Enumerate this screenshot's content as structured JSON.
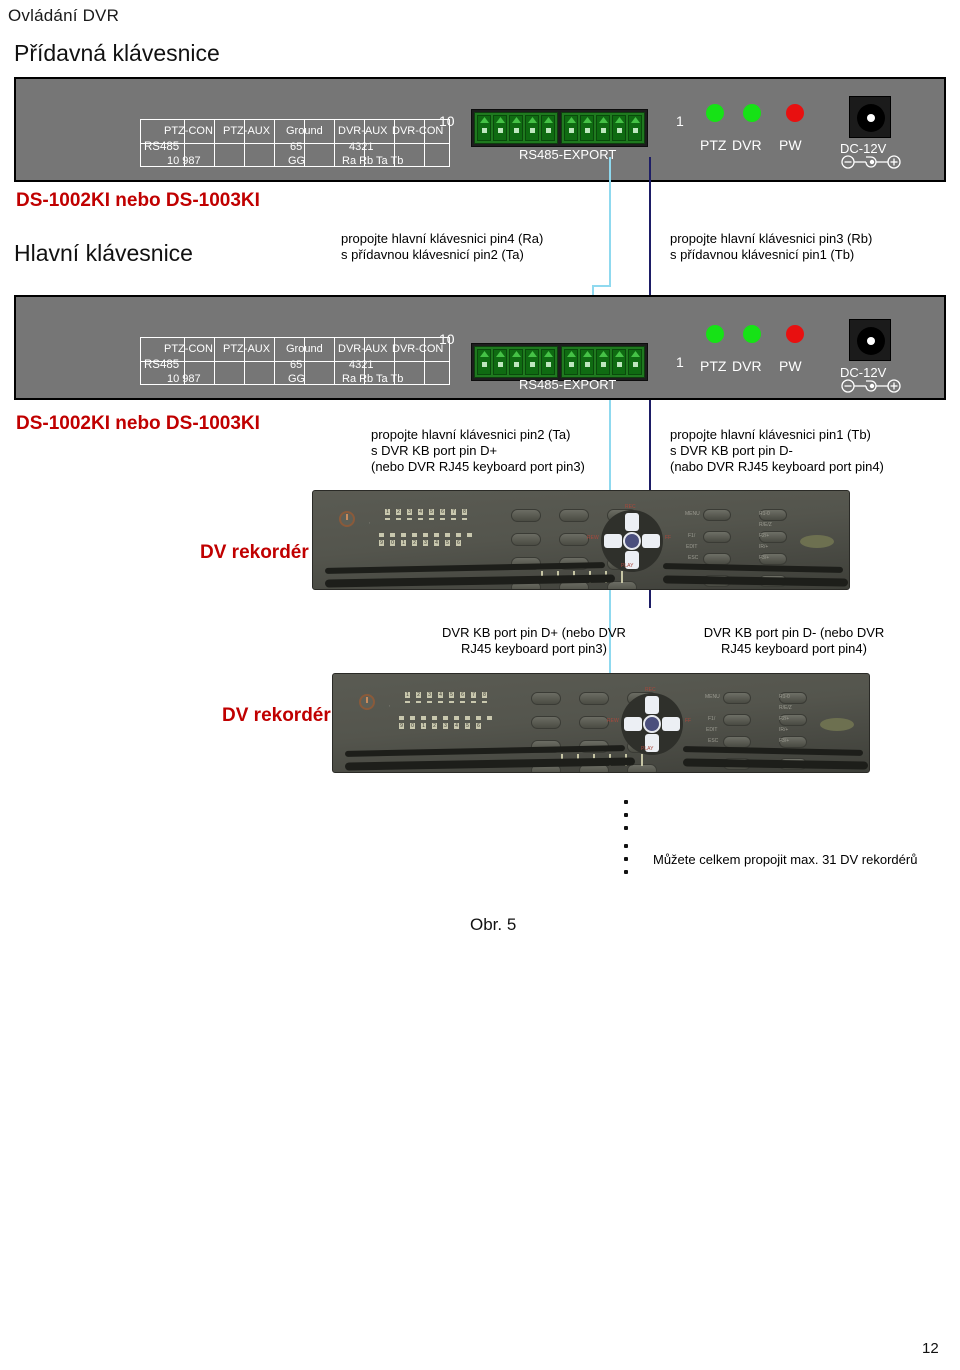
{
  "document": {
    "header": "Ovládání DVR",
    "figure_caption": "Obr. 5",
    "page_number": "12"
  },
  "sections": {
    "aux_keyboard_title": "Přídavná klávesnice",
    "main_keyboard_title": "Hlavní klávesnice",
    "model_label_1": "DS-1002KI nebo DS-1003KI",
    "model_label_2": "DS-1002KI nebo DS-1003KI",
    "dv_recorder_1": "DV rekordér",
    "dv_recorder_2": "DV rekordér"
  },
  "pin_table": {
    "rs485": "RS485",
    "ptz_con": "PTZ-CON",
    "ptz_aux": "PTZ-AUX",
    "ground": "Ground",
    "dvr_aux": "DVR-AUX",
    "dvr_con": "DVR-CON",
    "ptz_nums_top": "10 987",
    "ground_nums": "65",
    "ground_letters": "GG",
    "dvr_nums": "4321",
    "dvr_letters": "Ra Rb Ta Tb"
  },
  "terminal": {
    "label": "RS485-EXPORT",
    "num_left": "10",
    "num_right": "1",
    "pin_count": 10
  },
  "indicators": {
    "ptz_label": "PTZ",
    "dvr_label": "DVR",
    "pw_label": "PW",
    "ptz_color": "#16e216",
    "dvr_color": "#16e216",
    "pw_color": "#e81010",
    "dc_label": "DC-12V"
  },
  "annotations": {
    "a1_line1": "propojte hlavní klávesnici pin4 (Ra)",
    "a1_line2": "s přídavnou klávesnicí pin2 (Ta)",
    "a2_line1": "propojte hlavní klávesnici pin3 (Rb)",
    "a2_line2": "s přídavnou klávesnicí pin1 (Tb)",
    "b1_line1": "propojte hlavní klávesnici pin2 (Ta)",
    "b1_line2": "s DVR KB port pin D+",
    "b1_line3": "(nebo DVR  RJ45 keyboard port pin3)",
    "b2_line1": "propojte hlavní klávesnici pin1 (Tb)",
    "b2_line2": "s DVR KB port pin D-",
    "b2_line3": "(nabo DVR RJ45 keyboard port pin4)",
    "c1_line1": "DVR KB port pin D+ (nebo DVR",
    "c1_line2": "RJ45 keyboard port pin3)",
    "c2_line1": "DVR KB port pin D- (nebo DVR",
    "c2_line2": "RJ45 keyboard port pin4)",
    "footer_note": "Můžete celkem propojit max. 31 DV rekordérů"
  },
  "dvr_panel": {
    "led_labels_top": [
      "1",
      "2",
      "3",
      "4",
      "5",
      "6",
      "7",
      "8"
    ],
    "led_labels_bottom": [
      "9",
      "0",
      "1",
      "2",
      "3",
      "4",
      "5",
      "6"
    ],
    "side_labels": [
      "MENU",
      "",
      "F1/",
      "EDIT",
      "ESC"
    ],
    "right_labels": [
      "R1-0",
      "R/E/Z",
      "F2/+",
      "IR/+",
      "F3/+"
    ],
    "dpad_hints": [
      "REC",
      "REW",
      "FF",
      "PLAY"
    ]
  },
  "colors": {
    "panel_gray": "#767676",
    "terminal_green": "#0f6b12",
    "wire_light": "#8fd9ef",
    "wire_dark": "#1d1d66",
    "accent_red": "#c00000"
  }
}
